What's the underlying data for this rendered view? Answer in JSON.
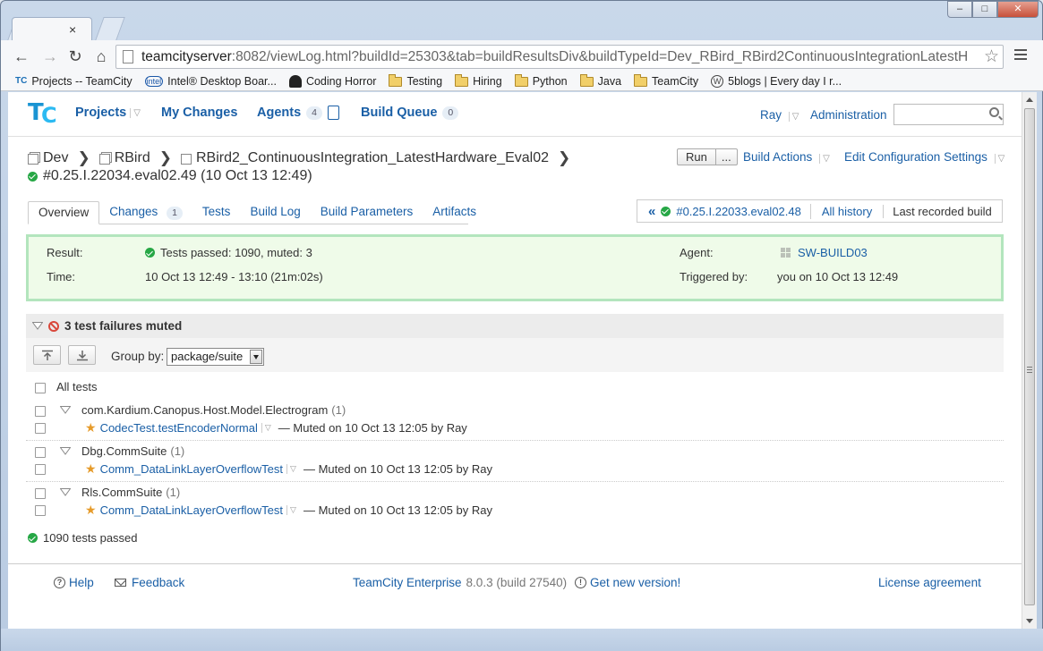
{
  "browser": {
    "url_host": "teamcityserver",
    "url_rest": ":8082/viewLog.html?buildId=25303&tab=buildResultsDiv&buildTypeId=Dev_RBird_RBird2ContinuousIntegrationLatestH",
    "tab_close": "×",
    "bookmarks": [
      {
        "icon": "teamcity-icon",
        "label": "Projects -- TeamCity"
      },
      {
        "icon": "intel-icon",
        "label": "Intel® Desktop Boar..."
      },
      {
        "icon": "coding-horror-icon",
        "label": "Coding Horror"
      },
      {
        "icon": "folder-icon",
        "label": "Testing"
      },
      {
        "icon": "folder-icon",
        "label": "Hiring"
      },
      {
        "icon": "folder-icon",
        "label": "Python"
      },
      {
        "icon": "folder-icon",
        "label": "Java"
      },
      {
        "icon": "folder-icon",
        "label": "TeamCity"
      },
      {
        "icon": "wordpress-icon",
        "label": "5blogs | Every day I r..."
      }
    ]
  },
  "header": {
    "logo_t": "T",
    "logo_c": "C",
    "projects": "Projects",
    "my_changes": "My Changes",
    "agents": "Agents",
    "agents_count": "4",
    "build_queue": "Build Queue",
    "queue_count": "0",
    "user": "Ray",
    "administration": "Administration"
  },
  "breadcrumb": {
    "items": [
      "Dev",
      "RBird",
      "RBird2_ContinuousIntegration_LatestHardware_Eval02"
    ],
    "build_title": "#0.25.I.22034.eval02.49 (10 Oct 13 12:49)"
  },
  "actions": {
    "run": "Run",
    "run_more": "...",
    "build_actions": "Build Actions",
    "edit_config": "Edit Configuration Settings"
  },
  "tabs": [
    {
      "label": "Overview",
      "active": true
    },
    {
      "label": "Changes",
      "count": "1"
    },
    {
      "label": "Tests"
    },
    {
      "label": "Build Log"
    },
    {
      "label": "Build Parameters"
    },
    {
      "label": "Artifacts"
    }
  ],
  "history": {
    "prev_marker": "«",
    "prev_build": "#0.25.I.22033.eval02.48",
    "all_history": "All history",
    "last_recorded": "Last recorded build"
  },
  "result": {
    "result_label": "Result:",
    "result_value": "Tests passed: 1090, muted: 3",
    "time_label": "Time:",
    "time_value": "10 Oct 13 12:49 - 13:10 (21m:02s)",
    "agent_label": "Agent:",
    "agent_value": "SW-BUILD03",
    "triggered_label": "Triggered by:",
    "triggered_value": "you on 10 Oct 13 12:49"
  },
  "muted": {
    "heading": "3 test failures muted",
    "group_by_label": "Group by:",
    "group_by_value": "package/suite",
    "all_tests": "All tests",
    "groups": [
      {
        "name": "com.Kardium.Canopus.Host.Model.Electrogram",
        "count": "(1)",
        "test": "CodecTest.testEncoderNormal",
        "note": "— Muted on 10 Oct 13 12:05 by Ray"
      },
      {
        "name": "Dbg.CommSuite",
        "count": "(1)",
        "test": "Comm_DataLinkLayerOverflowTest",
        "note": "— Muted on 10 Oct 13 12:05 by Ray"
      },
      {
        "name": "Rls.CommSuite",
        "count": "(1)",
        "test": "Comm_DataLinkLayerOverflowTest",
        "note": "— Muted on 10 Oct 13 12:05 by Ray"
      }
    ],
    "passed": "1090 tests passed"
  },
  "footer": {
    "help": "Help",
    "help_icon": "?",
    "feedback": "Feedback",
    "product": "TeamCity Enterprise",
    "version": "8.0.3 (build 27540)",
    "new_version": "Get new version!",
    "new_version_icon": "!",
    "license": "License agreement"
  },
  "colors": {
    "link": "#1a5fa6",
    "success": "#26a745",
    "result_bg": "#effbe9",
    "result_border": "#b3e5bd"
  }
}
